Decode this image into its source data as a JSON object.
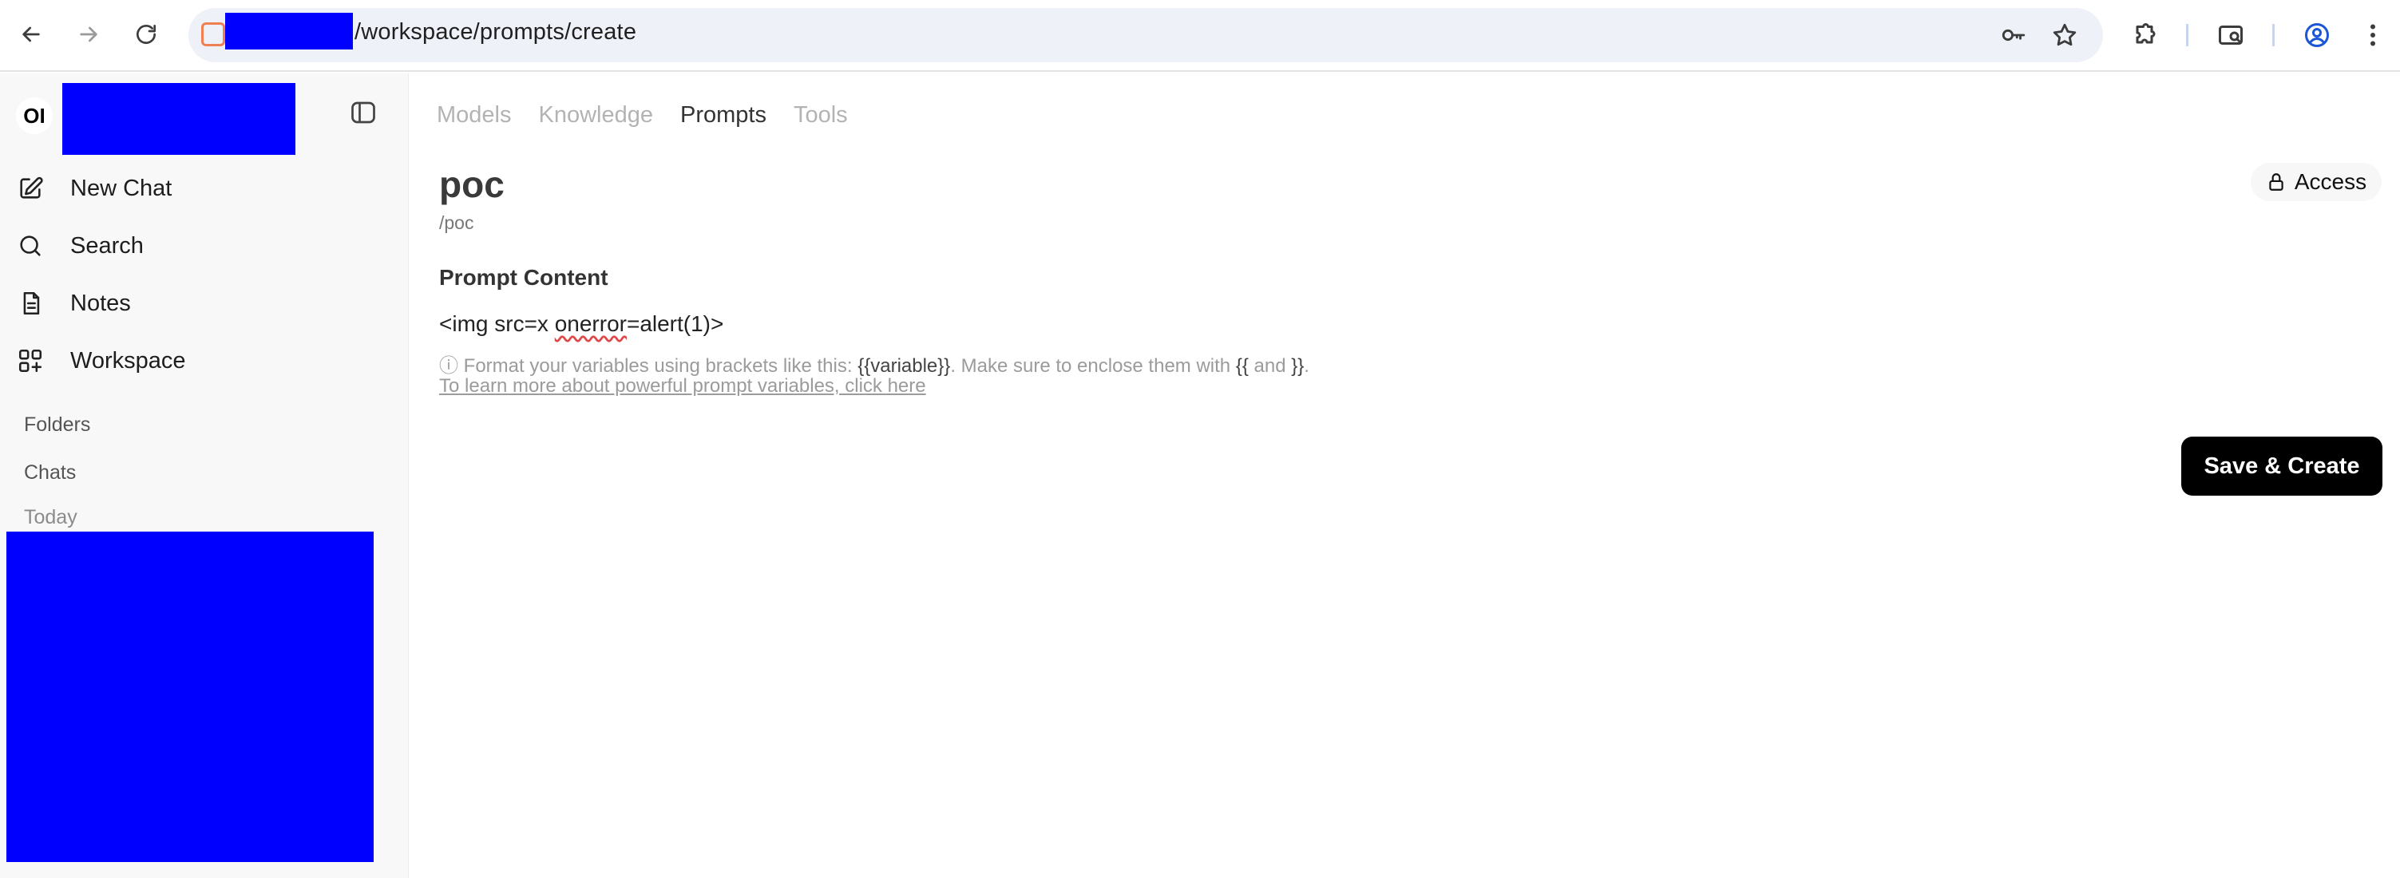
{
  "browser": {
    "url_path": "/workspace/prompts/create"
  },
  "sidebar": {
    "logo_text": "OI",
    "items": [
      {
        "label": "New Chat",
        "icon": "pencil-square-icon"
      },
      {
        "label": "Search",
        "icon": "search-icon"
      },
      {
        "label": "Notes",
        "icon": "notes-icon"
      },
      {
        "label": "Workspace",
        "icon": "workspace-grid-icon"
      }
    ],
    "sections": {
      "folders": "Folders",
      "chats": "Chats",
      "today": "Today"
    }
  },
  "main": {
    "tabs": [
      {
        "label": "Models",
        "active": false
      },
      {
        "label": "Knowledge",
        "active": false
      },
      {
        "label": "Prompts",
        "active": true
      },
      {
        "label": "Tools",
        "active": false
      }
    ],
    "title": "poc",
    "command_prefix": "/",
    "command": "poc",
    "access_label": "Access",
    "section_label": "Prompt Content",
    "prompt_before": "<img src=x ",
    "prompt_typo": "onerror",
    "prompt_after": "=alert(1)>",
    "hint": {
      "icon": "ⓘ",
      "part1": " Format your variables using brackets like this: ",
      "code1": "{{variable}}",
      "part2": ". Make sure to enclose them with ",
      "code2": "{{",
      "part3": " and ",
      "code3": "}}",
      "part4": "."
    },
    "learn_more": "To learn more about powerful prompt variables, click here",
    "save_label": "Save & Create"
  },
  "colors": {
    "redaction": "#0000ff",
    "accent": "#000000",
    "site_icon": "#f07f52"
  }
}
